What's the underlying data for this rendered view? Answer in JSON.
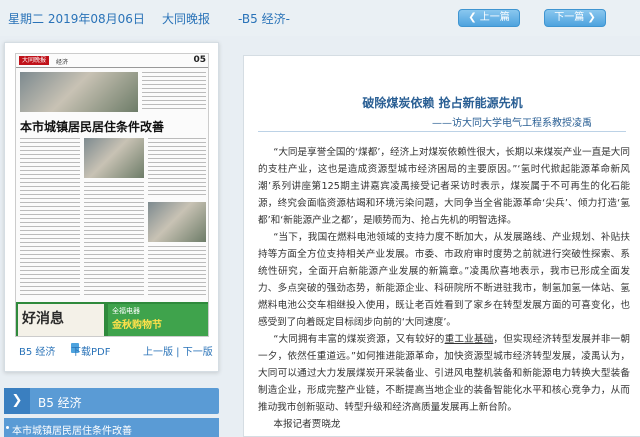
{
  "header": {
    "date": "星期二 2019年08月06日",
    "paper": "大同晚报",
    "section": "-B5 经济-",
    "prev_label": "上一篇",
    "next_label": "下一篇"
  },
  "thumbnail": {
    "logo": "大同晚报",
    "tag": "经济",
    "page_no": "05",
    "headline": "本市城镇居民居住条件改善",
    "ad_left": "好消息",
    "ad_right_top": "全福电器",
    "ad_right_main": "金秋购物节",
    "page_label": "B5 经济",
    "download_label": "下载PDF",
    "prev_next_label": "上一版 | 下一版"
  },
  "sidebar": {
    "section_label": "B5 经济",
    "items": [
      {
        "label": "本市城镇居民居住条件改善"
      }
    ]
  },
  "article": {
    "title": "破除煤炭依赖 抢占新能源先机",
    "subtitle": "——访大同大学电气工程系教授凌禹",
    "paragraphs": [
      {
        "before": "“大同是享誉全国的‘煤都’，经济上对煤炭依赖性很大，长期以来煤炭产业一直是大同的支柱产业，这也是造成资源型城市经济困局的主要原因。”‘氢时代掀起能源革命新风潮’系列讲座第125期主讲嘉宾凌禹接受记者采访时表示，煤炭属于不可再生的化石能源，终究会面临资源枯竭和环境污染问题，大同争当全省能源革命‘尖兵’、倾力打造‘氢都’和‘新能源产业之都’，是顺势而为、抢占先机的明智选择。",
        "underline": "",
        "after": ""
      },
      {
        "before": "“当下，我国在燃料电池领域的支持力度不断加大，从发展路线、产业规划、补贴扶持等方面全方位支持相关产业发展。市委、市政府审时度势之前就进行突破性探索、系统性研究，全面开启新能源产业发展的新篇章。”凌禹欣喜地表示，我市已形成全面发力、多点突破的强劲态势，新能源企业、科研院所不断进驻我市，制氢加氢一体站、氢燃料电池公交车相继投入使用，既让老百姓看到了家乡在转型发展方面的可喜变化，也感受到了向着既定目标阔步向前的‘大同速度’。",
        "underline": "",
        "after": ""
      },
      {
        "before": "“大同拥有丰富的煤炭资源，又有较好的",
        "underline": "重工业基础",
        "after": "，但实现经济转型发展并非一朝一夕，依然任重道远。”如何推进能源革命，加快资源型城市经济转型发展，凌禹认为，大同可以通过大力发展煤炭开采装备业、引进风电整机装备和新能源电力转换大型装备制造企业，形成完整产业链，不断提高当地企业的装备智能化水平和核心竞争力，从而推动我市创新驱动、转型升级和经济高质量发展再上新台阶。"
      },
      {
        "before": "本报记者贾晓龙",
        "underline": "",
        "after": ""
      }
    ]
  },
  "colors": {
    "accent": "#2a73b8",
    "button": "#4ea3de",
    "section_bg": "#5a9bd5",
    "title": "#2a5f94"
  }
}
